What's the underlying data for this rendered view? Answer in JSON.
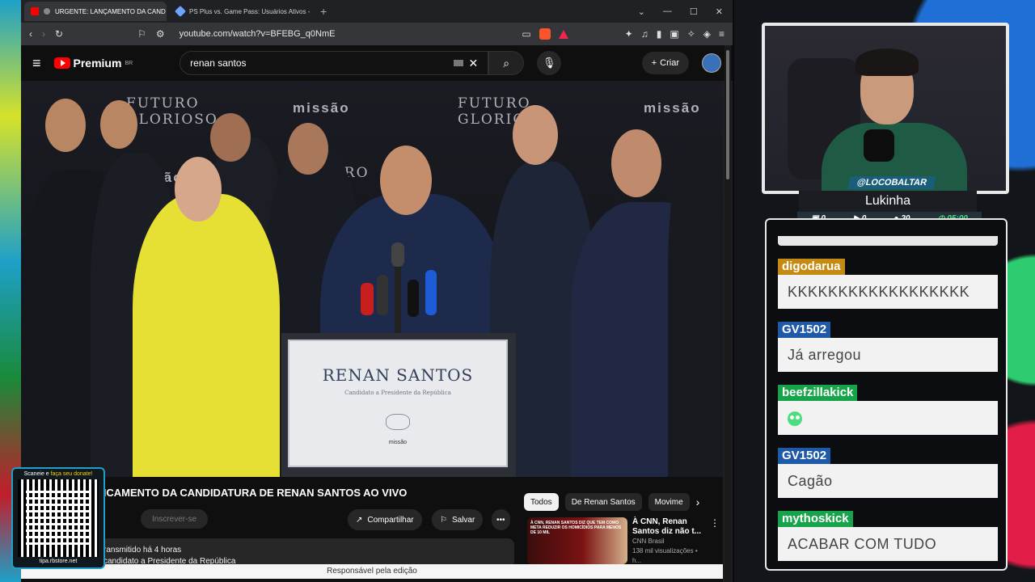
{
  "browser": {
    "tabs": [
      {
        "label": "URGENTE: LANÇAMENTO DA CAND",
        "active": true
      },
      {
        "label": "PS Plus vs. Game Pass: Usuários Ativos - Goo",
        "active": false
      }
    ],
    "new_tab": "+",
    "url": "youtube.com/watch?v=BFEBG_q0NmE"
  },
  "youtube": {
    "brand": "Premium",
    "region": "BR",
    "search_value": "renan santos",
    "create_label": "Criar"
  },
  "video": {
    "backdrop_texts": [
      "FUTURO",
      "GLORIOSO",
      "missão",
      "missão",
      "FUTURO",
      "GLORIOSO",
      "missão",
      "FUTURO"
    ],
    "podium_name": "RENAN SANTOS",
    "podium_sub": "Candidato a Presidente da República",
    "podium_brand": "missão"
  },
  "below": {
    "title": "NCAMENTO DA CANDIDATURA DE RENAN SANTOS AO VIVO",
    "subscribe": "Inscrever-se",
    "share": "Compartilhar",
    "save": "Salvar",
    "more": "•••",
    "desc_line1": "ransmitido há 4 horas",
    "desc_line2": "candidato a Presidente da República",
    "chips": [
      "Todos",
      "De Renan Santos",
      "Movime"
    ],
    "rec": {
      "thumb_text": "À CNN, RENAN SANTOS DIZ QUE TEM COMO META REDUZIR OS HOMICÍDIOS PARA MENOS DE 10 MIL",
      "title": "À CNN, Renan Santos diz não t...",
      "channel": "CNN Brasil",
      "meta": "138 mil visualizações • h..."
    },
    "footer": "Responsável pela edição"
  },
  "qr": {
    "top_prefix": "Scaneie e ",
    "top_highlight": "faça seu donate!",
    "bottom": "tipa.rbstore.net"
  },
  "streamer": {
    "handle": "@LOCOBALTAR",
    "name": "Lukinha",
    "stats": [
      "0",
      "0",
      "20",
      "05:00"
    ]
  },
  "chat": {
    "messages": [
      {
        "user": "digodarua",
        "text": "KKKKKKKKKKKKKKKKKK",
        "color": "#c58a12"
      },
      {
        "user": "GV1502",
        "text": "Já arregou",
        "color": "#1e5aa8"
      },
      {
        "user": "beefzillakick",
        "text": "",
        "color": "#16a34a",
        "emote": "kick-emote"
      },
      {
        "user": "GV1502",
        "text": "Cagão",
        "color": "#1e5aa8"
      },
      {
        "user": "mythoskick",
        "text": "ACABAR COM TUDO",
        "color": "#16a34a"
      }
    ]
  }
}
